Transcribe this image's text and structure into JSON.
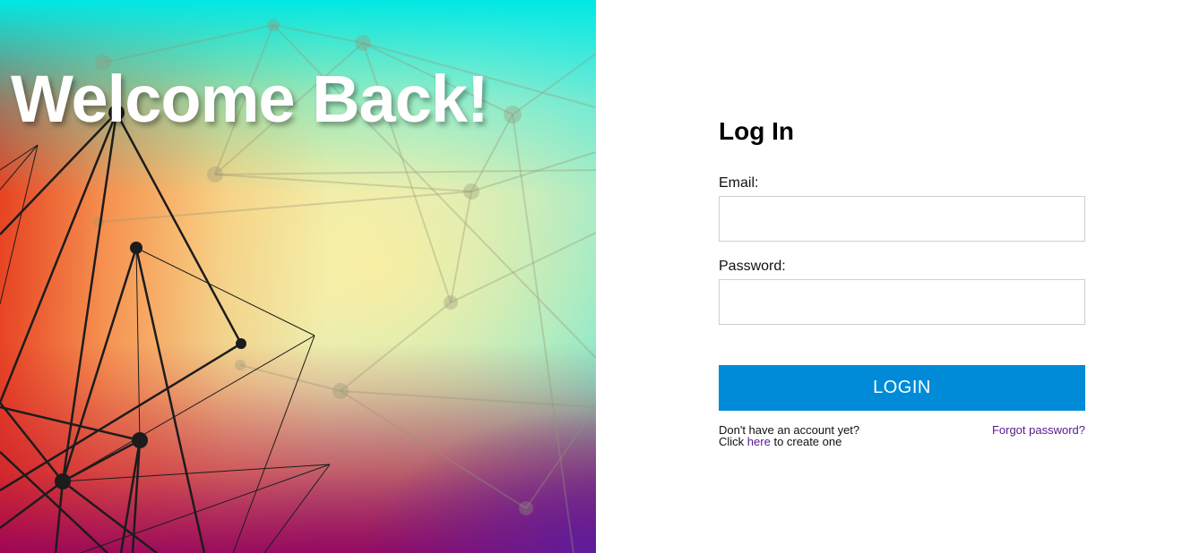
{
  "hero": {
    "title": "Welcome Back!"
  },
  "login": {
    "heading": "Log In",
    "email_label": "Email:",
    "email_value": "",
    "password_label": "Password:",
    "password_value": "",
    "button_label": "LOGIN",
    "no_account_text": "Don't have an account yet?",
    "click_text": "Click",
    "here_link": "here",
    "create_text": "to create one",
    "forgot_link": "Forgot password?"
  },
  "colors": {
    "button_bg": "#008bd8",
    "link": "#551a8b"
  }
}
